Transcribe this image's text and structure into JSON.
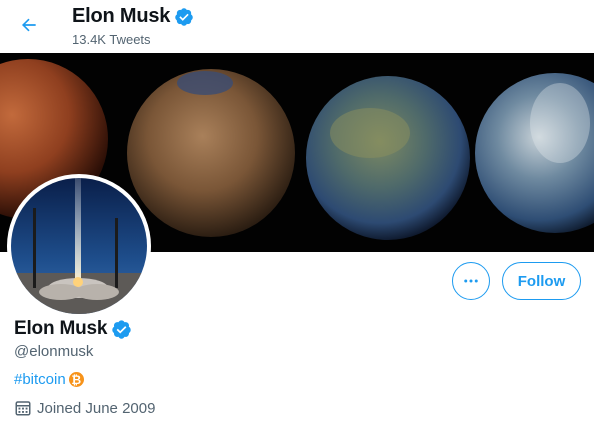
{
  "header": {
    "name": "Elon Musk",
    "tweet_count": "13.4K Tweets"
  },
  "profile": {
    "name": "Elon Musk",
    "handle": "@elonmusk",
    "bio_hashtag": "#bitcoin",
    "joined": "Joined June 2009"
  },
  "actions": {
    "follow_label": "Follow",
    "more_icon": "more-horizontal-icon"
  },
  "icons": {
    "back": "arrow-left-icon",
    "verified": "verified-badge-icon",
    "bitcoin": "bitcoin-icon",
    "calendar": "calendar-icon"
  },
  "colors": {
    "accent": "#1d9bf0",
    "text_primary": "#0f1419",
    "text_secondary": "#536471",
    "bitcoin": "#f7931a"
  }
}
